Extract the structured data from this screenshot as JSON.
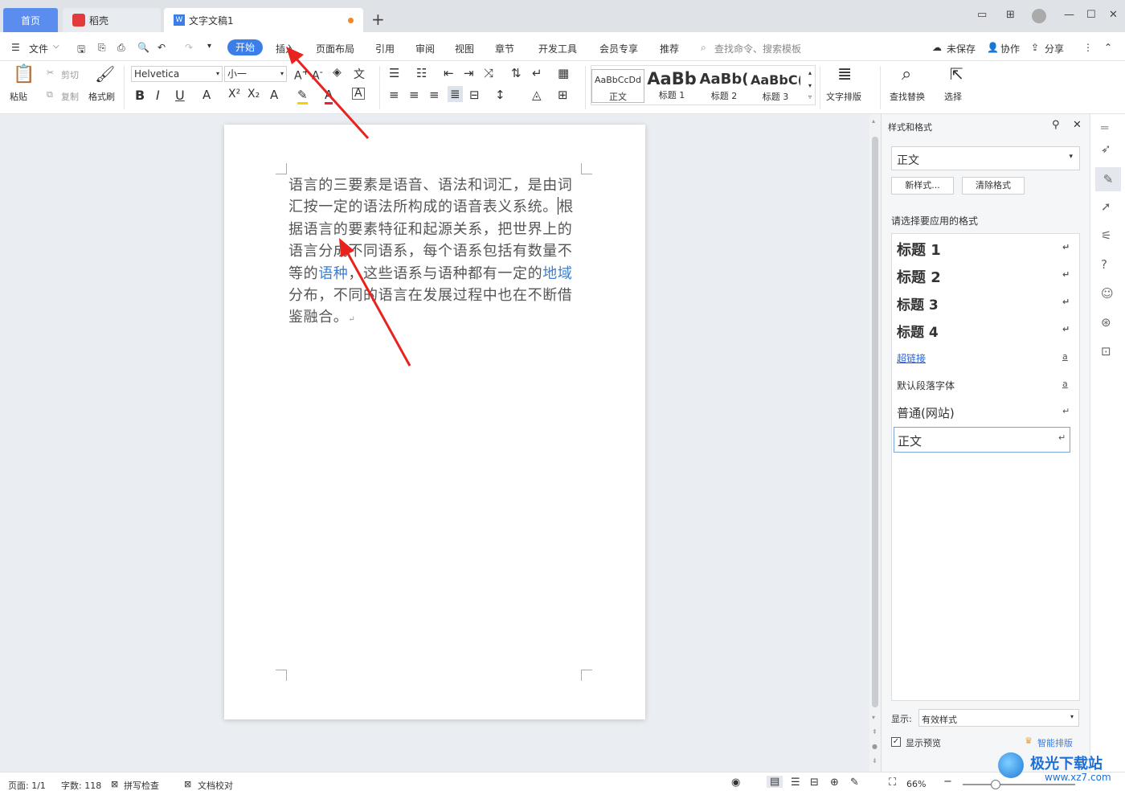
{
  "tabs": {
    "home": "首页",
    "daoke": "稻壳",
    "doc": "文字文稿1"
  },
  "menu": {
    "file": "文件",
    "items": [
      "开始",
      "插入",
      "页面布局",
      "引用",
      "审阅",
      "视图",
      "章节",
      "开发工具",
      "会员专享",
      "推荐"
    ],
    "search_placeholder": "查找命令、搜索模板",
    "unsaved": "未保存",
    "collab": "协作",
    "share": "分享"
  },
  "ribbon": {
    "paste": "粘贴",
    "cut": "剪切",
    "copy": "复制",
    "format_painter": "格式刷",
    "font": "Helvetica",
    "size": "小一",
    "styles": [
      {
        "preview": "AaBbCcDd",
        "label": "正文"
      },
      {
        "preview": "AaBb",
        "label": "标题 1"
      },
      {
        "preview": "AaBb(",
        "label": "标题 2"
      },
      {
        "preview": "AaBbC(",
        "label": "标题 3"
      }
    ],
    "text_layout": "文字排版",
    "find_replace": "查找替换",
    "select": "选择"
  },
  "document": {
    "p1": "语言的三要素是语音、语法和词汇，是由词汇按一定的语法所构成的语音表义系统。",
    "p2": "根据语言的要素特征和起源关系，把世界上的语言分成不同语系，每个语系包括有数量不等的",
    "link1": "语种",
    "p3": "，这些语系与语种都有一定的",
    "link2": "地域",
    "p4": "分布，不同的语言在发展过程中也在不断借鉴融合。",
    "para_mark": "↵"
  },
  "panel": {
    "title": "样式和格式",
    "current": "正文",
    "new_style": "新样式...",
    "clear_format": "清除格式",
    "apply_label": "请选择要应用的格式",
    "styles": [
      "标题 1",
      "标题 2",
      "标题 3",
      "标题 4",
      "超链接",
      "默认段落字体",
      "普通(网站)",
      "正文"
    ],
    "show_label": "显示:",
    "show_value": "有效样式",
    "preview": "显示预览",
    "smart": "智能排版"
  },
  "status": {
    "page": "页面: 1/1",
    "words": "字数: 118",
    "spell": "拼写检查",
    "proof": "文档校对",
    "zoom": "66%"
  },
  "watermark": {
    "site": "极光下载站",
    "url": "www.xz7.com"
  },
  "colors": {
    "accent": "#3b7de9",
    "arrow": "#e8231f"
  }
}
